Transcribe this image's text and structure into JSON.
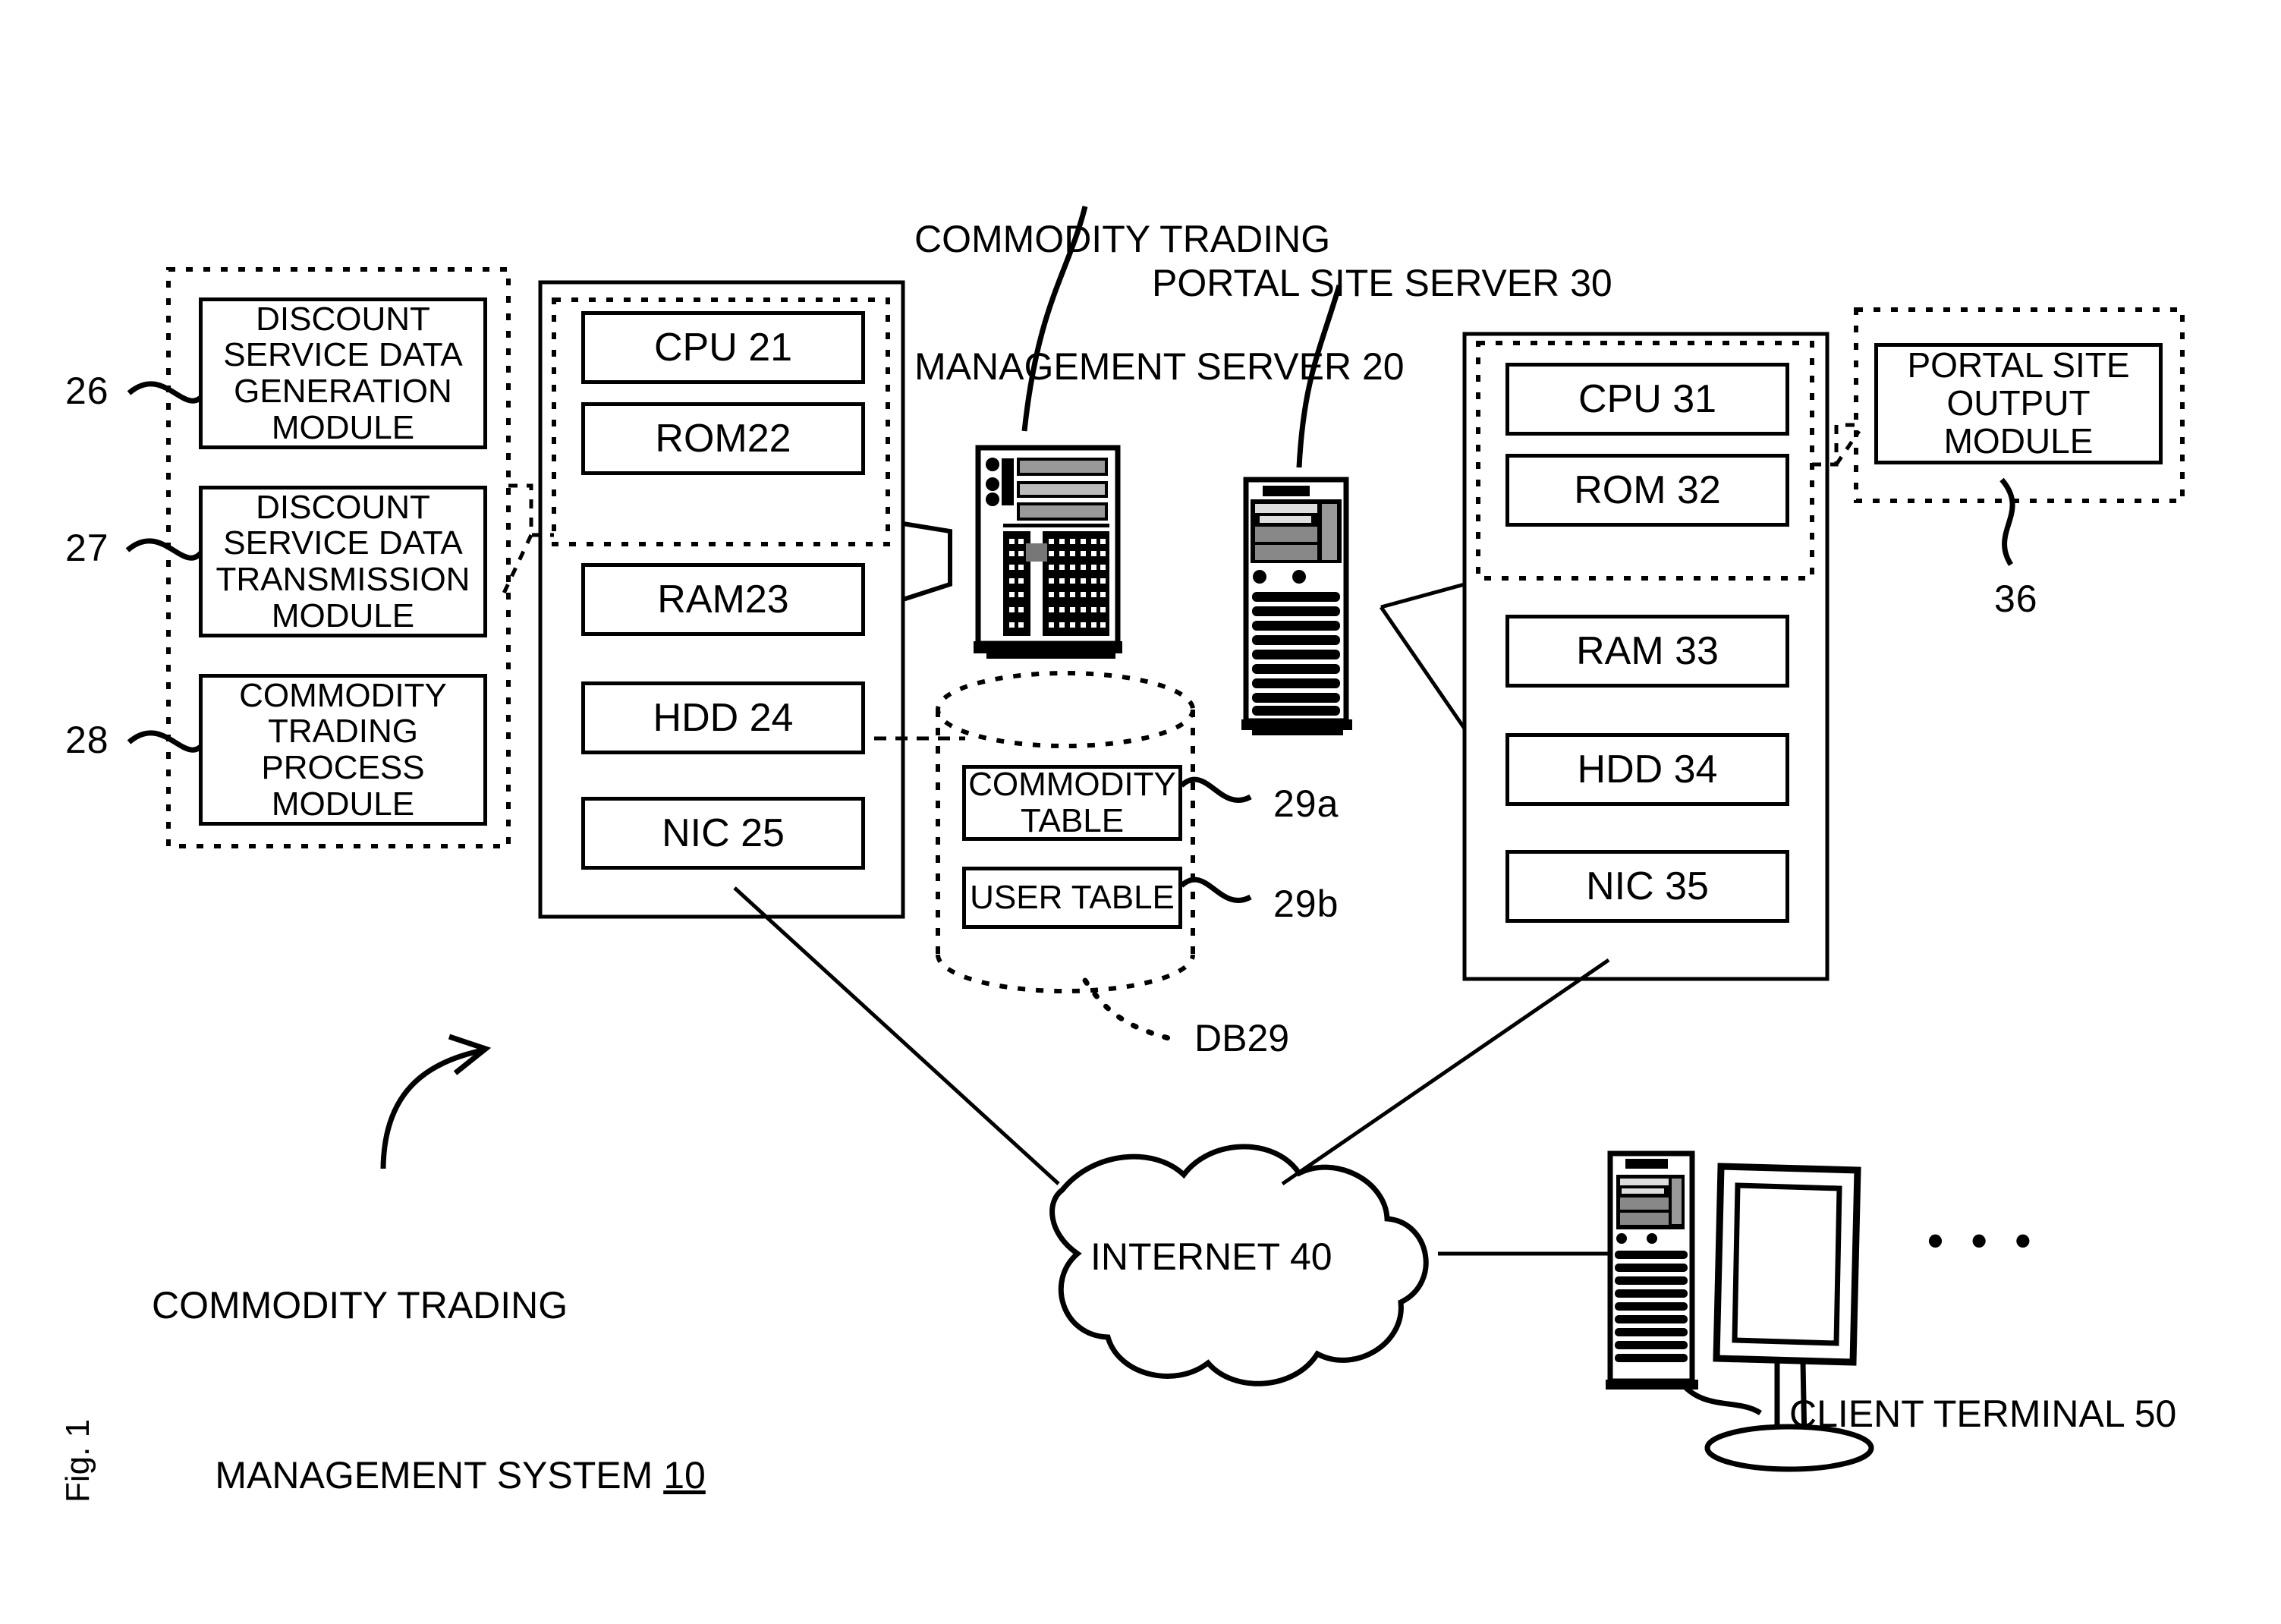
{
  "figure": {
    "label": "Fig. 1",
    "system_caption_line1": "COMMODITY TRADING",
    "system_caption_line2": "MANAGEMENT SYSTEM ",
    "system_caption_ref": "10"
  },
  "callouts": {
    "server20_line1": "COMMODITY TRADING",
    "server20_line2": "MANAGEMENT SERVER 20",
    "server30": "PORTAL SITE SERVER 30",
    "client50": "CLIENT TERMINAL 50",
    "db29": "DB29",
    "ellipsis": "• • •"
  },
  "modules_group": {
    "items": [
      {
        "ref": "26",
        "lines": [
          "DISCOUNT",
          "SERVICE DATA",
          "GENERATION",
          "MODULE"
        ]
      },
      {
        "ref": "27",
        "lines": [
          "DISCOUNT",
          "SERVICE DATA",
          "TRANSMISSION",
          "MODULE"
        ]
      },
      {
        "ref": "28",
        "lines": [
          "COMMODITY",
          "TRADING",
          "PROCESS",
          "MODULE"
        ]
      }
    ]
  },
  "server20": {
    "name": "COMMODITY TRADING MANAGEMENT SERVER 20",
    "components": [
      {
        "label": "CPU 21"
      },
      {
        "label": "ROM22"
      },
      {
        "label": "RAM23"
      },
      {
        "label": "HDD 24"
      },
      {
        "label": "NIC 25"
      }
    ]
  },
  "server30": {
    "name": "PORTAL SITE SERVER 30",
    "components": [
      {
        "label": "CPU 31"
      },
      {
        "label": "ROM 32"
      },
      {
        "label": "RAM 33"
      },
      {
        "label": "HDD 34"
      },
      {
        "label": "NIC 35"
      }
    ]
  },
  "portal_output_module": {
    "ref": "36",
    "lines": [
      "PORTAL SITE",
      "OUTPUT MODULE"
    ]
  },
  "database": {
    "label": "DB29",
    "tables": [
      {
        "ref": "29a",
        "lines": [
          "COMMODITY",
          "TABLE"
        ]
      },
      {
        "ref": "29b",
        "lines": [
          "USER TABLE"
        ]
      }
    ]
  },
  "network": {
    "cloud_label": "INTERNET 40"
  },
  "colors": {
    "ink": "#000000",
    "paper": "#ffffff"
  }
}
